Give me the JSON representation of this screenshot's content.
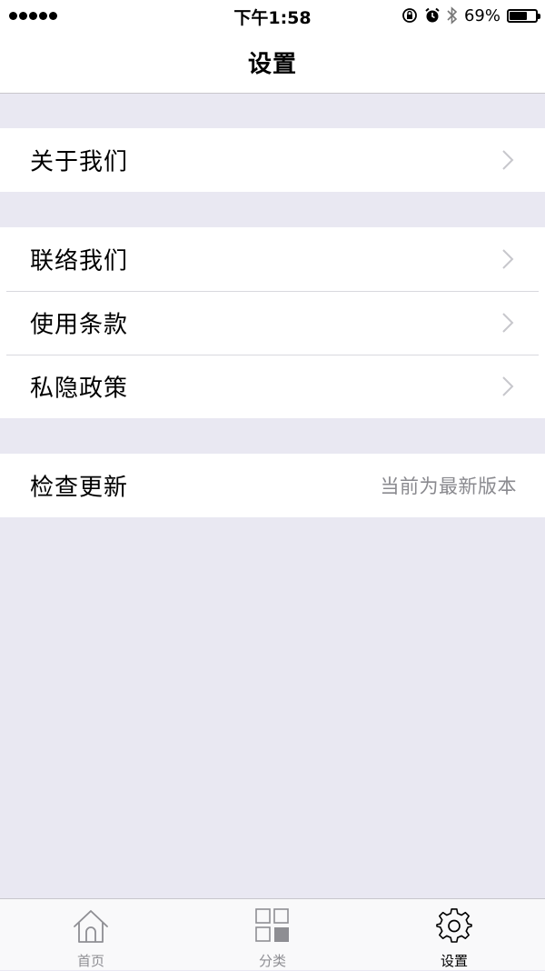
{
  "status_bar": {
    "time": "下午1:58",
    "battery_percent": "69%",
    "battery_level": 0.69,
    "icons": [
      "signal-dots",
      "orientation-lock-icon",
      "alarm-icon",
      "bluetooth-icon",
      "battery-icon"
    ]
  },
  "nav": {
    "title": "设置"
  },
  "groups": {
    "about": {
      "label": "关于我们"
    },
    "contact": {
      "label": "联络我们"
    },
    "terms": {
      "label": "使用条款"
    },
    "privacy": {
      "label": "私隐政策"
    },
    "update": {
      "label": "检查更新",
      "value": "当前为最新版本"
    }
  },
  "tab_bar": {
    "home": {
      "label": "首页",
      "icon": "home-icon"
    },
    "category": {
      "label": "分类",
      "icon": "grid-icon"
    },
    "settings": {
      "label": "设置",
      "icon": "gear-icon",
      "active": true
    }
  },
  "colors": {
    "background": "#e9e8f2",
    "secondary_text": "#8a8a8f",
    "chevron": "#c7c7cc"
  }
}
